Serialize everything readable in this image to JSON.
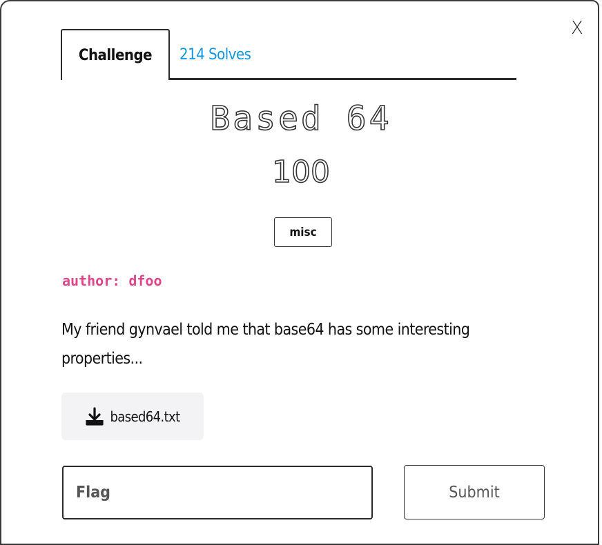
{
  "close_label": "X",
  "tabs": [
    {
      "label": "Challenge",
      "active": true
    },
    {
      "label": "214 Solves",
      "active": false
    }
  ],
  "challenge": {
    "name": "Based 64",
    "value": "100",
    "category": "misc",
    "author": "author: dfoo",
    "description": "My friend gynvael told me that base64 has some interesting properties..."
  },
  "file": {
    "name": "based64.txt",
    "icon": "download-icon"
  },
  "form": {
    "flag_placeholder": "Flag",
    "submit_label": "Submit"
  },
  "colors": {
    "solves_link": "#1296e0",
    "author": "#e0458a",
    "file_bg": "#f3f3f5"
  }
}
